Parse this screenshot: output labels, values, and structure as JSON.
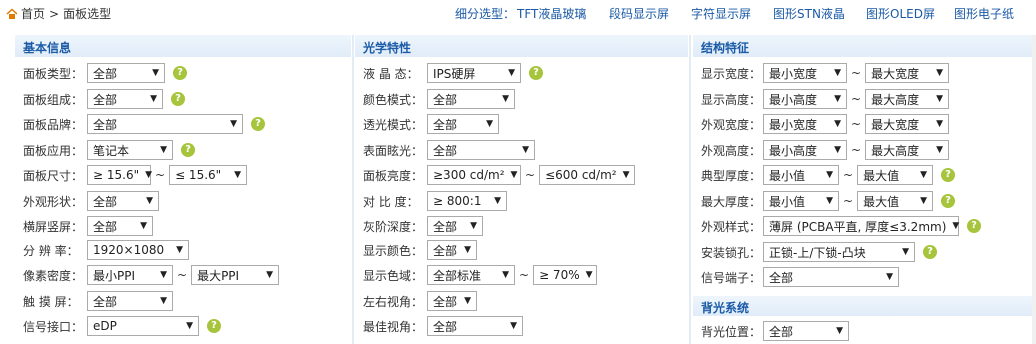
{
  "breadcrumb": {
    "home": "首页",
    "separator": ">",
    "current": "面板选型"
  },
  "sub_selection": {
    "label": "细分选型：",
    "links": [
      "TFT液晶玻璃",
      "段码显示屏",
      "字符显示屏",
      "图形STN液晶",
      "图形OLED屏",
      "图形电子纸"
    ]
  },
  "colors": {
    "link": "#1a5aa6",
    "header_bg": "#e0ecf8",
    "help_icon": "#a6c43c"
  },
  "basic": {
    "title": "基本信息",
    "rows": [
      {
        "label": "面板类型：",
        "values": [
          "全部"
        ]
      },
      {
        "label": "面板组成：",
        "values": [
          "全部"
        ]
      },
      {
        "label": "面板品牌：",
        "values": [
          "全部"
        ]
      },
      {
        "label": "面板应用：",
        "values": [
          "笔记本"
        ]
      },
      {
        "label": "面板尺寸：",
        "values": [
          "≥ 15.6\"",
          "≤ 15.6\""
        ]
      },
      {
        "label": "外观形状：",
        "values": [
          "全部"
        ]
      },
      {
        "label": "横屏竖屏：",
        "values": [
          "全部"
        ]
      },
      {
        "label": "分 辨 率：",
        "values": [
          "1920×1080"
        ]
      },
      {
        "label": "像素密度：",
        "values": [
          "最小PPI",
          "最大PPI"
        ]
      },
      {
        "label": "触 摸 屏：",
        "values": [
          "全部"
        ]
      },
      {
        "label": "信号接口：",
        "values": [
          "eDP"
        ]
      }
    ]
  },
  "optical": {
    "title": "光学特性",
    "rows": [
      {
        "label": "液 晶 态：",
        "values": [
          "IPS硬屏"
        ]
      },
      {
        "label": "颜色模式：",
        "values": [
          "全部"
        ]
      },
      {
        "label": "透光模式：",
        "values": [
          "全部"
        ]
      },
      {
        "label": "表面眩光：",
        "values": [
          "全部"
        ]
      },
      {
        "label": "面板亮度：",
        "values": [
          "≥300 cd/m²",
          "≤600 cd/m²"
        ]
      },
      {
        "label": "对 比 度：",
        "values": [
          "≥ 800:1"
        ]
      },
      {
        "label": "灰阶深度：",
        "values": [
          "全部"
        ]
      },
      {
        "label": "显示颜色：",
        "values": [
          "全部"
        ]
      },
      {
        "label": "显示色域：",
        "values": [
          "全部标准",
          "≥ 70%"
        ]
      },
      {
        "label": "左右视角：",
        "values": [
          "全部"
        ]
      },
      {
        "label": "最佳视角：",
        "values": [
          "全部"
        ]
      }
    ]
  },
  "structure": {
    "title": "结构特征",
    "rows": [
      {
        "label": "显示宽度：",
        "values": [
          "最小宽度",
          "最大宽度"
        ]
      },
      {
        "label": "显示高度：",
        "values": [
          "最小高度",
          "最大高度"
        ]
      },
      {
        "label": "外观宽度：",
        "values": [
          "最小宽度",
          "最大宽度"
        ]
      },
      {
        "label": "外观高度：",
        "values": [
          "最小高度",
          "最大高度"
        ]
      },
      {
        "label": "典型厚度：",
        "values": [
          "最小值",
          "最大值"
        ]
      },
      {
        "label": "最大厚度：",
        "values": [
          "最小值",
          "最大值"
        ]
      },
      {
        "label": "外观样式：",
        "values": [
          "薄屏 (PCBA平直, 厚度≤3.2mm)"
        ]
      },
      {
        "label": "安装锁孔：",
        "values": [
          "正锁-上/下锁-凸块"
        ]
      },
      {
        "label": "信号端子：",
        "values": [
          "全部"
        ]
      }
    ]
  },
  "backlight": {
    "title": "背光系统",
    "rows": [
      {
        "label": "背光位置：",
        "values": [
          "全部"
        ]
      }
    ]
  },
  "help_glyph": "?"
}
